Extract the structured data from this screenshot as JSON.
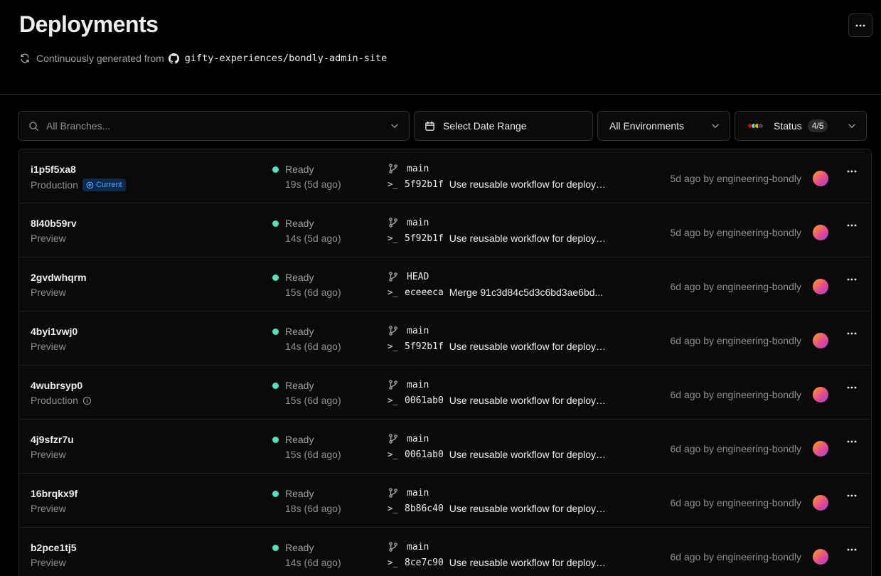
{
  "page": {
    "title": "Deployments",
    "subtitle_prefix": "Continuously generated from",
    "repo": "gifty-experiences/bondly-admin-site"
  },
  "filters": {
    "branch_placeholder": "All Branches...",
    "date_label": "Select Date Range",
    "environment_label": "All Environments",
    "status_label": "Status",
    "status_count": "4/5",
    "status_dot_colors": [
      "#ee0000",
      "#50e3c2",
      "#f5a623",
      "#444444"
    ]
  },
  "deployments": [
    {
      "id": "i1p5f5xa8",
      "environment": "Production",
      "current_label": "Current",
      "state": "Ready",
      "duration": "19s (5d ago)",
      "branch": "main",
      "sha": "5f92b1f",
      "message": "Use reusable workflow for deployment",
      "by": "5d ago by engineering-bondly"
    },
    {
      "id": "8l40b59rv",
      "environment": "Preview",
      "state": "Ready",
      "duration": "14s (5d ago)",
      "branch": "main",
      "sha": "5f92b1f",
      "message": "Use reusable workflow for deployment",
      "by": "5d ago by engineering-bondly"
    },
    {
      "id": "2gvdwhqrm",
      "environment": "Preview",
      "state": "Ready",
      "duration": "15s (6d ago)",
      "branch": "HEAD",
      "sha": "eceeeca",
      "message": "Merge 91c3d84c5d3c6bd3ae6bd...",
      "by": "6d ago by engineering-bondly"
    },
    {
      "id": "4byi1vwj0",
      "environment": "Preview",
      "state": "Ready",
      "duration": "14s (6d ago)",
      "branch": "main",
      "sha": "5f92b1f",
      "message": "Use reusable workflow for deployment",
      "by": "6d ago by engineering-bondly"
    },
    {
      "id": "4wubrsyp0",
      "environment": "Production",
      "state": "Ready",
      "duration": "15s (6d ago)",
      "branch": "main",
      "sha": "0061ab0",
      "message": "Use reusable workflow for deployment",
      "by": "6d ago by engineering-bondly"
    },
    {
      "id": "4j9sfzr7u",
      "environment": "Preview",
      "state": "Ready",
      "duration": "15s (6d ago)",
      "branch": "main",
      "sha": "0061ab0",
      "message": "Use reusable workflow for deployment",
      "by": "6d ago by engineering-bondly"
    },
    {
      "id": "16brqkx9f",
      "environment": "Preview",
      "state": "Ready",
      "duration": "18s (6d ago)",
      "branch": "main",
      "sha": "8b86c40",
      "message": "Use reusable workflow for deployment",
      "by": "6d ago by engineering-bondly"
    },
    {
      "id": "b2pce1tj5",
      "environment": "Preview",
      "state": "Ready",
      "duration": "14s (6d ago)",
      "branch": "main",
      "sha": "8ce7c90",
      "message": "Use reusable workflow for deployment",
      "by": "6d ago by engineering-bondly"
    }
  ],
  "colors": {
    "ready": "#50e3c2",
    "current_badge_bg": "#0c2a4d",
    "current_badge_text": "#52a8ff"
  }
}
